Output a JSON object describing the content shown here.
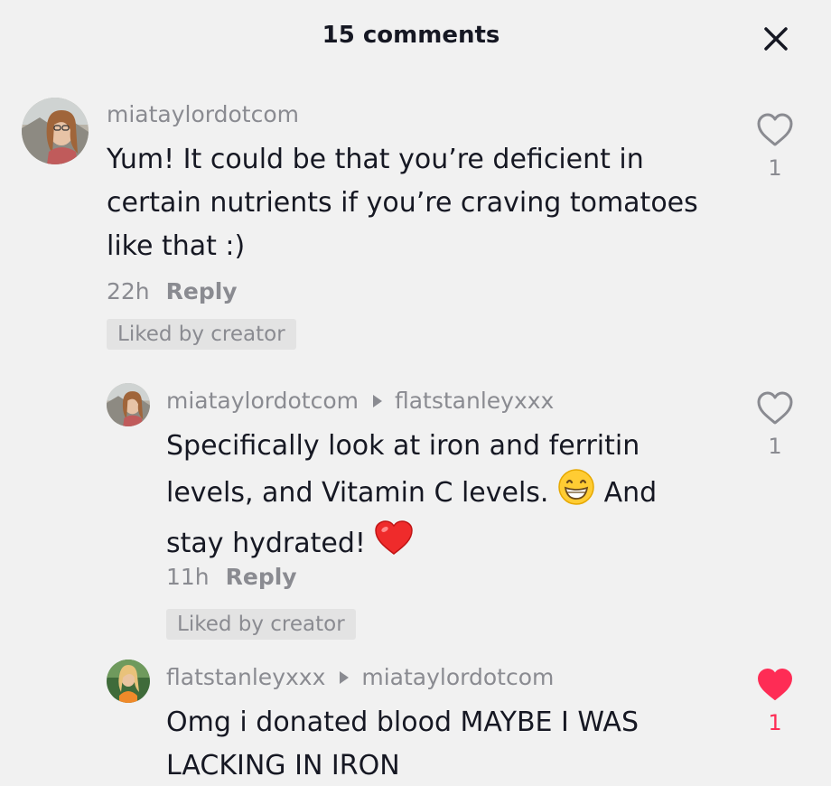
{
  "header": {
    "title": "15 comments",
    "close_icon": "close-icon"
  },
  "comments": [
    {
      "username": "miataylordotcom",
      "text": "Yum! It could be that you’re deficient in certain nutrients if you’re craving tomatoes like that :)",
      "time": "22h",
      "reply_label": "Reply",
      "liked_badge": "Liked by creator",
      "like_count": "1",
      "liked": false
    },
    {
      "username": "miataylordotcom",
      "reply_to": "flatstanleyxxx",
      "text_parts": [
        "Specifically look at iron and ferritin levels, and Vitamin C levels.",
        "And stay hydrated!"
      ],
      "time": "11h",
      "reply_label": "Reply",
      "liked_badge": "Liked by creator",
      "like_count": "1",
      "liked": false
    },
    {
      "username": "flatstanleyxxx",
      "reply_to": "miataylordotcom",
      "text": "Omg i donated blood MAYBE I WAS LACKING IN IRON",
      "like_count": "1",
      "liked": true
    }
  ],
  "colors": {
    "background": "#f1f1f1",
    "muted_text": "#8a8b91",
    "liked_heart": "#fe2c55",
    "badge_bg": "#e3e3e3"
  }
}
